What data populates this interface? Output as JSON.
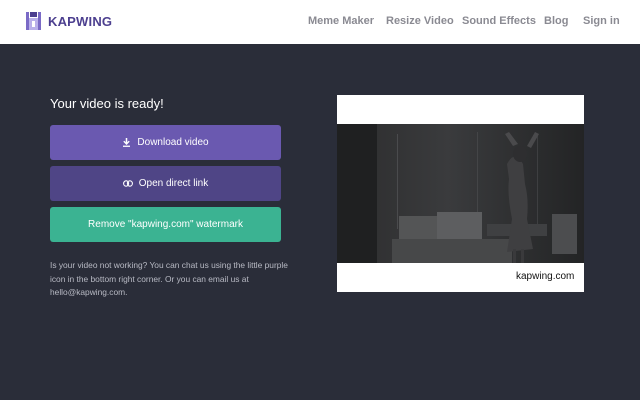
{
  "brand": {
    "name": "KAPWING",
    "logo_icon": "kapwing-logo-icon",
    "color": "#4c3f8f"
  },
  "nav": {
    "items": [
      "Meme Maker",
      "Resize Video",
      "Sound Effects",
      "Blog",
      "Sign in"
    ]
  },
  "main": {
    "title": "Your video is ready!",
    "download_label": "Download video",
    "download_icon": "download-icon",
    "link_label": "Open direct link",
    "link_icon": "link-icon",
    "remove_label": "Remove \"kapwing.com\" watermark",
    "help_text": "Is your video not working? You can chat us using the little purple icon in the bottom right corner. Or you can email us at hello@kapwing.com."
  },
  "preview": {
    "watermark": "kapwing.com"
  },
  "colors": {
    "accent": "#6a59b0",
    "secondary": "#4f4586",
    "success": "#3bb392",
    "background": "#2a2d39"
  }
}
